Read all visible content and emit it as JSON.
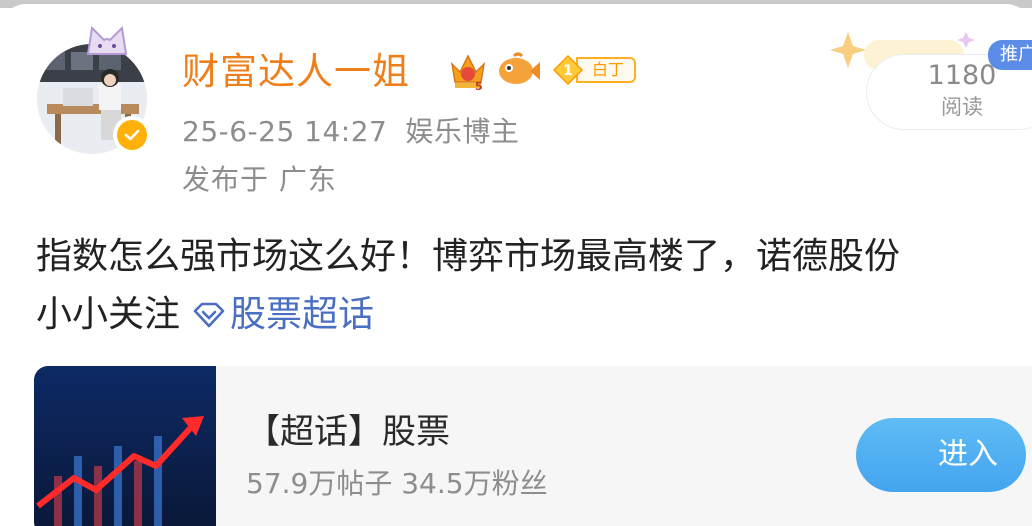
{
  "user": {
    "name": "财富达人一姐",
    "level_tag": "白丁",
    "level_num": "1",
    "crown_num": "5"
  },
  "post": {
    "date": "25-6-25 14:27",
    "category": "娱乐博主",
    "location": "发布于 广东",
    "text_line1": "指数怎么强市场这么好！博弈市场最高楼了，诺德股份",
    "text_line2": "小小关注",
    "topic_link": "股票超话"
  },
  "stats": {
    "read_count": "1180",
    "read_label": "阅读",
    "promo_tag": "推广"
  },
  "topic_card": {
    "title": "【超话】股票",
    "stats": "57.9万帖子 34.5万粉丝",
    "enter_label": "进入"
  },
  "colors": {
    "username": "#ee7f1a",
    "link": "#4a6ec1",
    "verified": "#ffb10a",
    "button": "#44a4ef"
  }
}
